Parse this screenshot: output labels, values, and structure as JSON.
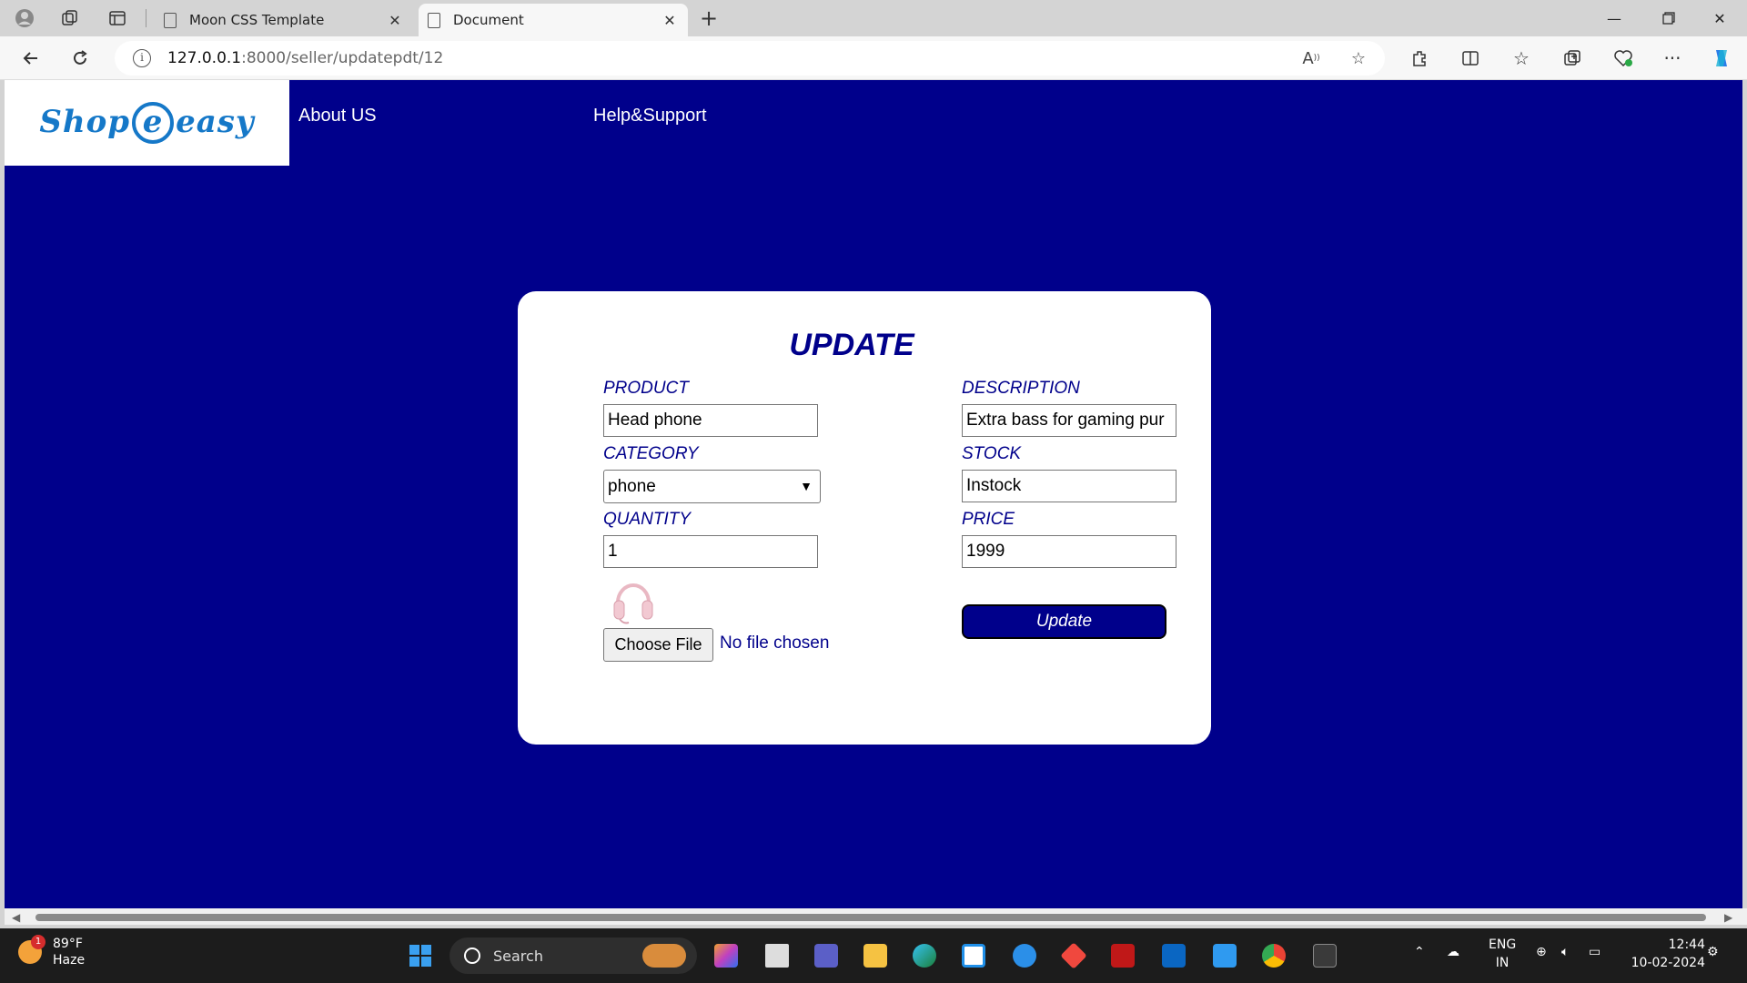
{
  "browser": {
    "tabs": [
      {
        "title": "Moon CSS Template"
      },
      {
        "title": "Document"
      }
    ],
    "url_host": "127.0.0.1",
    "url_path": ":8000/seller/updatepdt/12"
  },
  "site": {
    "logo_text_1": "Shop",
    "logo_text_e": "e",
    "logo_text_2": "easy",
    "nav": [
      "About US",
      "Help&Support"
    ]
  },
  "form": {
    "title": "UPDATE",
    "product_label": "PRODUCT",
    "product_value": "Head phone",
    "description_label": "DESCRIPTION",
    "description_value": "Extra bass for gaming pur",
    "category_label": "CATEGORY",
    "category_value": "phone",
    "stock_label": "STOCK",
    "stock_value": "Instock",
    "quantity_label": "QUANTITY",
    "quantity_value": "1",
    "price_label": "PRICE",
    "price_value": "1999",
    "file_button": "Choose File",
    "file_status": "No file chosen",
    "submit_label": "Update"
  },
  "taskbar": {
    "weather_temp": "89°F",
    "weather_desc": "Haze",
    "weather_badge": "1",
    "search_label": "Search",
    "lang_1": "ENG",
    "lang_2": "IN",
    "time": "12:44",
    "date": "10-02-2024"
  },
  "colors": {
    "page_bg": "#00008b",
    "card_bg": "#ffffff",
    "logo_blue": "#1578c8"
  }
}
